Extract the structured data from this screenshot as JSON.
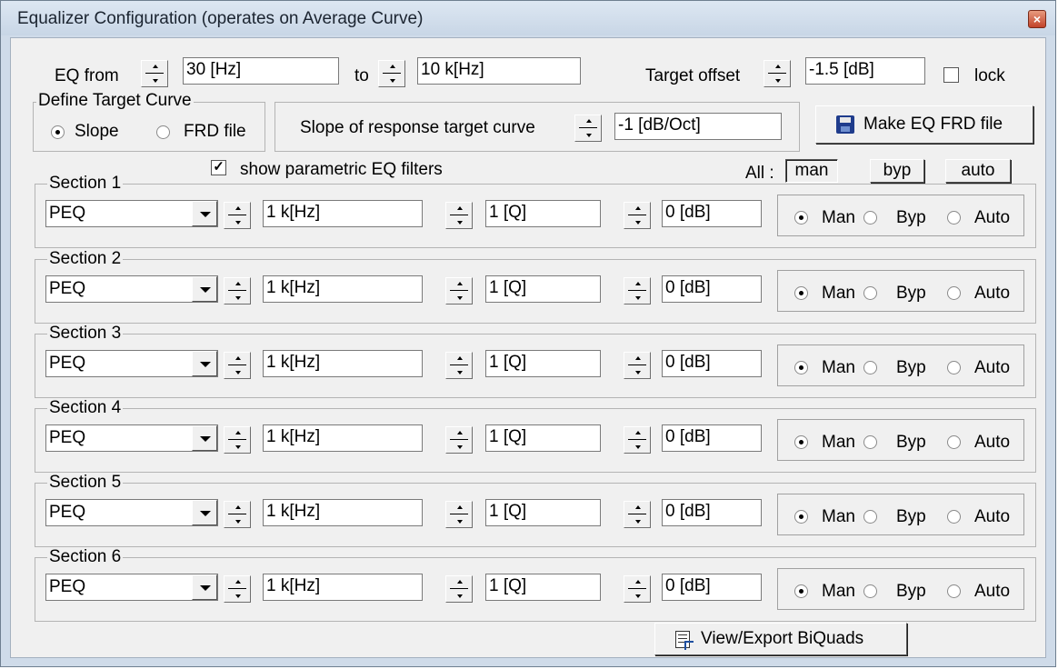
{
  "window": {
    "title": "Equalizer Configuration (operates on Average Curve)",
    "close": "×"
  },
  "eq_range": {
    "from_label": "EQ from",
    "from_value": "30 [Hz]",
    "to_label": "to",
    "to_value": "10 k[Hz]",
    "offset_label": "Target offset",
    "offset_value": "-1.5 [dB]",
    "lock_label": "lock"
  },
  "target_curve": {
    "group_title": "Define Target Curve",
    "slope_label": "Slope",
    "frd_label": "FRD file",
    "selected": "Slope",
    "slope_text": "Slope of response target curve",
    "slope_value": "-1 [dB/Oct]"
  },
  "make_eq_button": "Make EQ FRD file",
  "show_filters": {
    "label": "show parametric EQ filters",
    "checked": true
  },
  "all_controls": {
    "label": "All :",
    "man": "man",
    "byp": "byp",
    "auto": "auto"
  },
  "sections": [
    {
      "title": "Section 1",
      "type": "PEQ",
      "freq": "1 k[Hz]",
      "q": "1 [Q]",
      "gain": "0 [dB]",
      "man": "Man",
      "byp": "Byp",
      "auto": "Auto",
      "mode": "Man"
    },
    {
      "title": "Section 2",
      "type": "PEQ",
      "freq": "1 k[Hz]",
      "q": "1 [Q]",
      "gain": "0 [dB]",
      "man": "Man",
      "byp": "Byp",
      "auto": "Auto",
      "mode": "Man"
    },
    {
      "title": "Section 3",
      "type": "PEQ",
      "freq": "1 k[Hz]",
      "q": "1 [Q]",
      "gain": "0 [dB]",
      "man": "Man",
      "byp": "Byp",
      "auto": "Auto",
      "mode": "Man"
    },
    {
      "title": "Section 4",
      "type": "PEQ",
      "freq": "1 k[Hz]",
      "q": "1 [Q]",
      "gain": "0 [dB]",
      "man": "Man",
      "byp": "Byp",
      "auto": "Auto",
      "mode": "Man"
    },
    {
      "title": "Section 5",
      "type": "PEQ",
      "freq": "1 k[Hz]",
      "q": "1 [Q]",
      "gain": "0 [dB]",
      "man": "Man",
      "byp": "Byp",
      "auto": "Auto",
      "mode": "Man"
    },
    {
      "title": "Section 6",
      "type": "PEQ",
      "freq": "1 k[Hz]",
      "q": "1 [Q]",
      "gain": "0 [dB]",
      "man": "Man",
      "byp": "Byp",
      "auto": "Auto",
      "mode": "Man"
    }
  ],
  "biquads_button": "View/Export BiQuads"
}
